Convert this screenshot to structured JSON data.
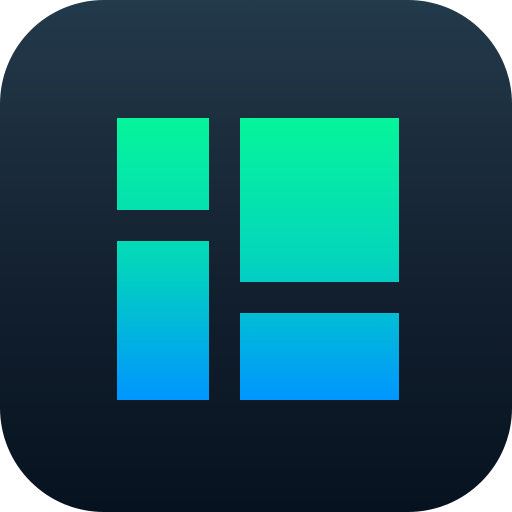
{
  "app_icon": {
    "icon_name": "layout-grid-icon",
    "background_colors": [
      "#233a4b",
      "#06121f"
    ],
    "glyph_gradient_colors": [
      "#06f59b",
      "#03d6bb",
      "#0096ff"
    ],
    "tiles": [
      "top-left",
      "bottom-left",
      "top-right",
      "bottom-right"
    ]
  }
}
